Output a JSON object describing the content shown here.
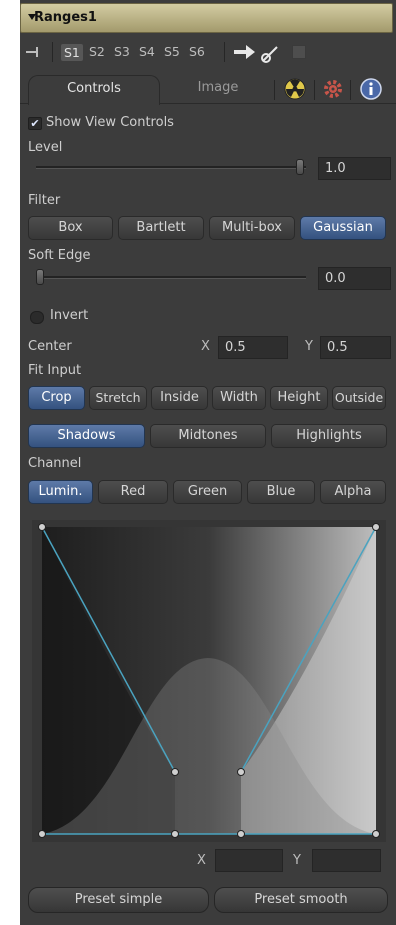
{
  "header": {
    "title": "Ranges1"
  },
  "slots": {
    "items": [
      "S1",
      "S2",
      "S3",
      "S4",
      "S5",
      "S6"
    ],
    "active": "S1"
  },
  "tabs": {
    "controls": "Controls",
    "image": "Image"
  },
  "show_view_controls": {
    "label": "Show View Controls",
    "checked": true
  },
  "level": {
    "label": "Level",
    "value": "1.0"
  },
  "filter": {
    "label": "Filter",
    "options": [
      "Box",
      "Bartlett",
      "Multi-box",
      "Gaussian"
    ],
    "selected": "Gaussian"
  },
  "soft_edge": {
    "label": "Soft Edge",
    "value": "0.0"
  },
  "invert": {
    "label": "Invert",
    "checked": false
  },
  "center": {
    "label": "Center",
    "x_label": "X",
    "x_value": "0.5",
    "y_label": "Y",
    "y_value": "0.5"
  },
  "fit_input": {
    "label": "Fit Input",
    "options": [
      "Crop",
      "Stretch",
      "Inside",
      "Width",
      "Height",
      "Outside"
    ],
    "selected": "Crop"
  },
  "ranges": {
    "options": [
      "Shadows",
      "Midtones",
      "Highlights"
    ],
    "selected": "Shadows"
  },
  "channel": {
    "label": "Channel",
    "options": [
      "Lumin.",
      "Red",
      "Green",
      "Blue",
      "Alpha"
    ],
    "selected": "Lumin."
  },
  "curve_coords": {
    "x_label": "X",
    "x_value": "",
    "y_label": "Y",
    "y_value": ""
  },
  "presets": {
    "simple": "Preset simple",
    "smooth": "Preset smooth"
  },
  "colors": {
    "accent": "#3d5c8c",
    "header": "#c9c190",
    "curve_line": "#4aa3c0",
    "panel": "#3c3c3c"
  }
}
